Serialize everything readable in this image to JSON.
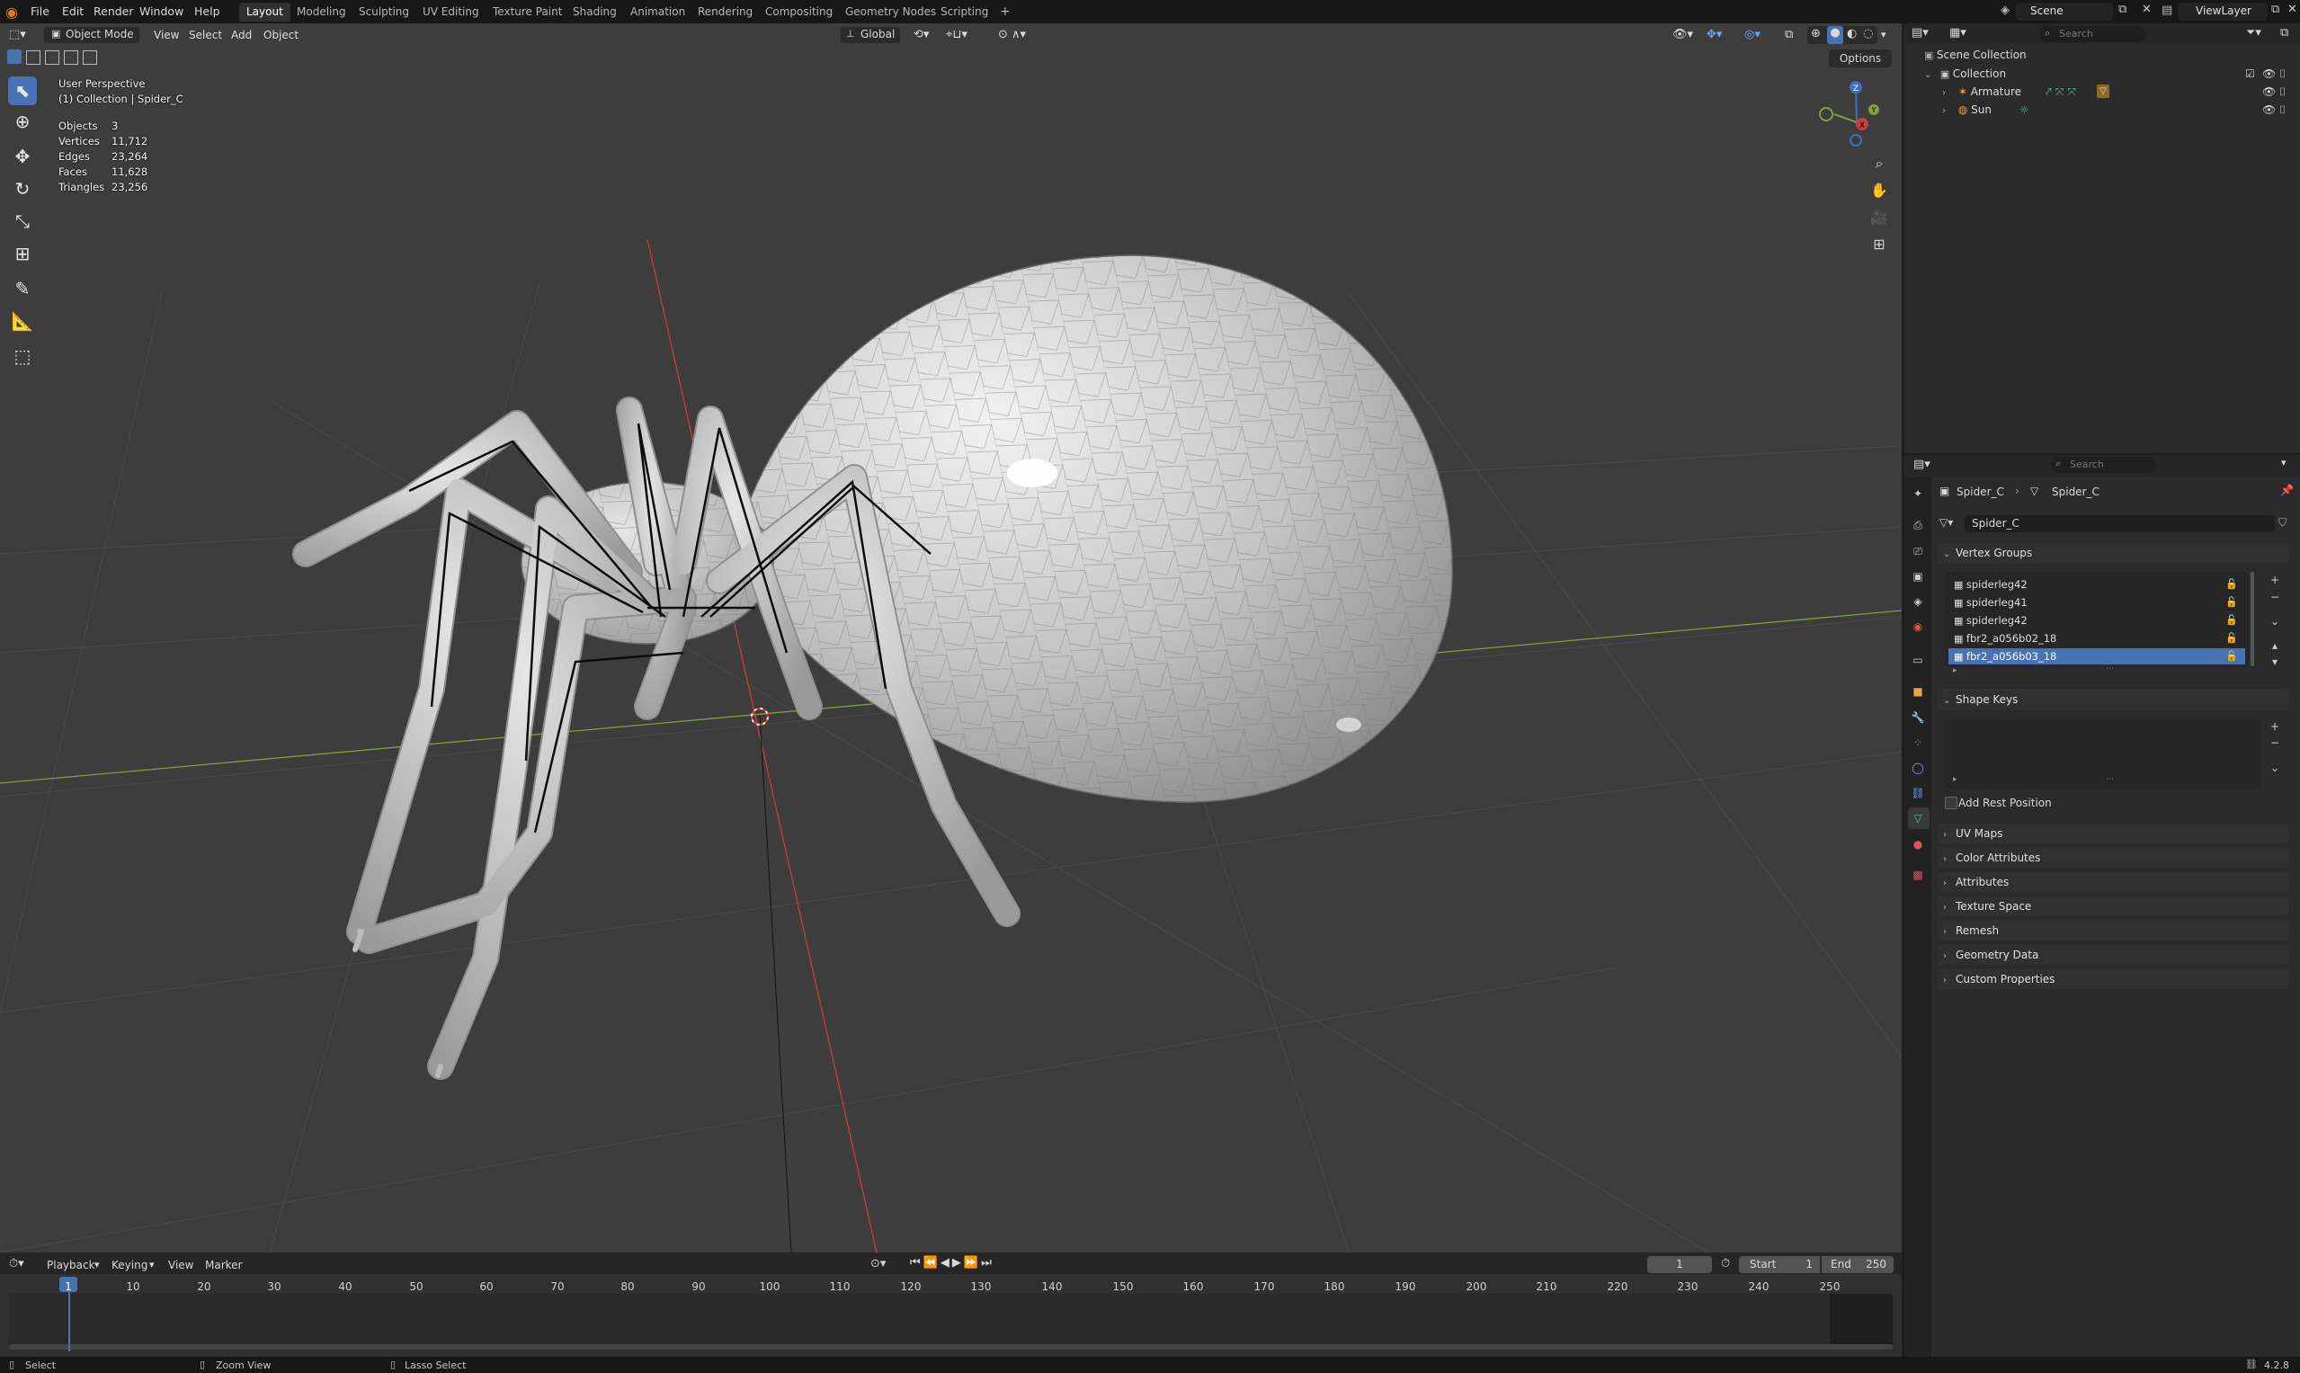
{
  "app": {
    "menu": [
      "File",
      "Edit",
      "Render",
      "Window",
      "Help"
    ],
    "workspaces": [
      "Layout",
      "Modeling",
      "Sculpting",
      "UV Editing",
      "Texture Paint",
      "Shading",
      "Animation",
      "Rendering",
      "Compositing",
      "Geometry Nodes",
      "Scripting"
    ],
    "active_workspace": "Layout",
    "add_workspace": "+",
    "scene": "Scene",
    "view_layer": "ViewLayer"
  },
  "viewport_header": {
    "mode": "Object Mode",
    "menus": [
      "View",
      "Select",
      "Add",
      "Object"
    ],
    "orientation": "Global",
    "options": "Options"
  },
  "viewport": {
    "perspective": "User Perspective",
    "collection_line": "(1) Collection | Spider_C",
    "stats": [
      {
        "label": "Objects",
        "value": "3"
      },
      {
        "label": "Vertices",
        "value": "11,712"
      },
      {
        "label": "Edges",
        "value": "23,264"
      },
      {
        "label": "Faces",
        "value": "11,628"
      },
      {
        "label": "Triangles",
        "value": "23,256"
      }
    ],
    "gizmo": {
      "z": "Z",
      "x": "X",
      "y": "Y"
    }
  },
  "timeline": {
    "menus": [
      "Playback",
      "Keying",
      "View",
      "Marker"
    ],
    "current_frame": "1",
    "start_label": "Start",
    "start": "1",
    "end_label": "End",
    "end": "250",
    "ticks": [
      "1",
      "10",
      "20",
      "30",
      "40",
      "50",
      "60",
      "70",
      "80",
      "90",
      "100",
      "110",
      "120",
      "130",
      "140",
      "150",
      "160",
      "170",
      "180",
      "190",
      "200",
      "210",
      "220",
      "230",
      "240",
      "250"
    ]
  },
  "statusbar": {
    "select": "Select",
    "zoom": "Zoom View",
    "lasso": "Lasso Select",
    "version": "4.2.8"
  },
  "outliner": {
    "search_placeholder": "Search",
    "root": "Scene Collection",
    "collection": "Collection",
    "items": [
      "Armature",
      "Sun"
    ]
  },
  "properties": {
    "search_placeholder": "Search",
    "breadcrumb_object": "Spider_C",
    "breadcrumb_data": "Spider_C",
    "mesh_name": "Spider_C",
    "vertex_groups_title": "Vertex Groups",
    "vertex_groups": [
      "spiderleg42",
      "spiderleg41",
      "spiderleg42",
      "fbr2_a056b02_18",
      "fbr2_a056b03_18"
    ],
    "selected_group": 4,
    "shape_keys_title": "Shape Keys",
    "add_rest_position": "Add Rest Position",
    "panels": [
      "UV Maps",
      "Color Attributes",
      "Attributes",
      "Texture Space",
      "Remesh",
      "Geometry Data",
      "Custom Properties"
    ]
  },
  "colors": {
    "accent": "#4772b3",
    "x_axis": "#c93d3d",
    "y_axis": "#7fa03a",
    "z_axis": "#3d6ec9"
  }
}
